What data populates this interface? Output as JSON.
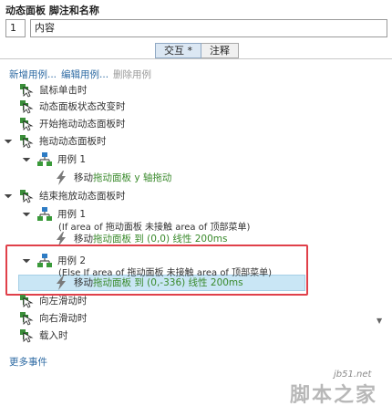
{
  "panel": {
    "title": "动态面板 脚注和名称",
    "footnote": "1",
    "name": "内容"
  },
  "tabs": [
    {
      "label": "交互 *"
    },
    {
      "label": "注释"
    }
  ],
  "actions": {
    "new_case": "新增用例...",
    "edit_case": "编辑用例...",
    "delete_case": "删除用例"
  },
  "tree": {
    "e1": "鼠标单击时",
    "e2": "动态面板状态改变时",
    "e3": "开始拖动动态面板时",
    "e4": "拖动动态面板时",
    "e4_case": "用例 1",
    "e4_act_prefix": "移动 ",
    "e4_act_green": "拖动面板 y 轴拖动",
    "e5": "结束拖放动态面板时",
    "e5_case1": "用例 1",
    "e5_case1_cond": "(If area of 拖动面板 未接触 area of 顶部菜单)",
    "e5_case1_act_prefix": "移动 ",
    "e5_case1_act_green": "拖动面板 到 (0,0) 线性 200ms",
    "e5_case2": "用例 2",
    "e5_case2_cond": "(Else If area of 拖动面板 未接触 area of 顶部菜单)",
    "e5_case2_act_prefix": "移动 ",
    "e5_case2_act_green": "拖动面板 到 (0,-336) 线性 200ms",
    "e6": "向左滑动时",
    "e7": "向右滑动时",
    "e8": "载入时"
  },
  "more_events": "更多事件",
  "watermark": {
    "top": "jb51.net",
    "bottom": "脚本之家"
  },
  "colors": {
    "link": "#2d6aa3",
    "action_green": "#3a8a2c",
    "selection": "#c9e6f5",
    "highlight": "#e0404a"
  },
  "icons": {
    "event": "hand-cursor-icon",
    "case": "case-tree-icon",
    "action": "lightning-icon",
    "expanded": "triangle-expanded-icon"
  }
}
